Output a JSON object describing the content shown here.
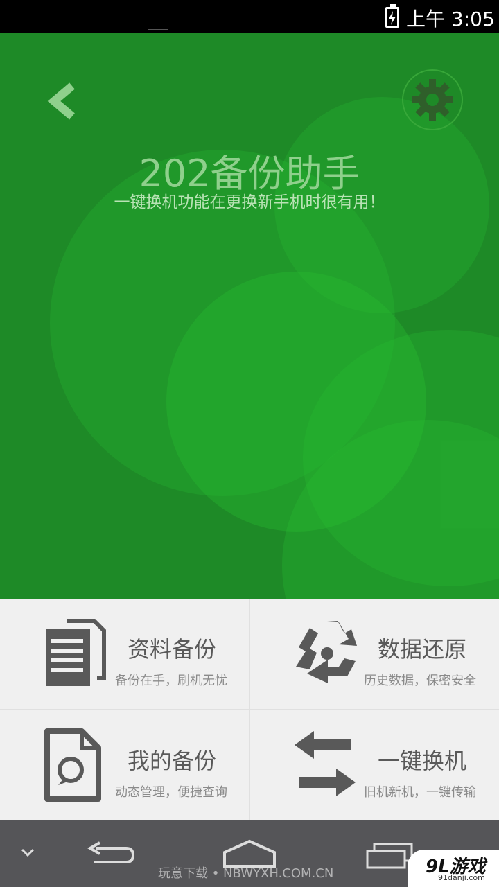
{
  "status_bar": {
    "time": "上午 3:05"
  },
  "header": {
    "title": "202备份助手",
    "subtitle": "一键换机功能在更换新手机时很有用！",
    "back_icon": "chevron-left-icon",
    "settings_icon": "gear-icon"
  },
  "colors": {
    "hero_bg": "#1e8a27",
    "tile_bg": "#f0f0f0",
    "icon_gray": "#595959",
    "nav_bg": "#555558"
  },
  "features": [
    {
      "title": "资料备份",
      "subtitle": "备份在手，刷机无忧",
      "icon": "documents-icon"
    },
    {
      "title": "数据还原",
      "subtitle": "历史数据，保密安全",
      "icon": "recycle-icon"
    },
    {
      "title": "我的备份",
      "subtitle": "动态管理，便捷查询",
      "icon": "file-chat-icon"
    },
    {
      "title": "一键换机",
      "subtitle": "旧机新机，一键传输",
      "icon": "swap-arrows-icon"
    }
  ],
  "watermark": "玩意下载 • NBWYXH.COM.CN",
  "logo": {
    "main": "9L游戏",
    "url": "91danji.com"
  }
}
